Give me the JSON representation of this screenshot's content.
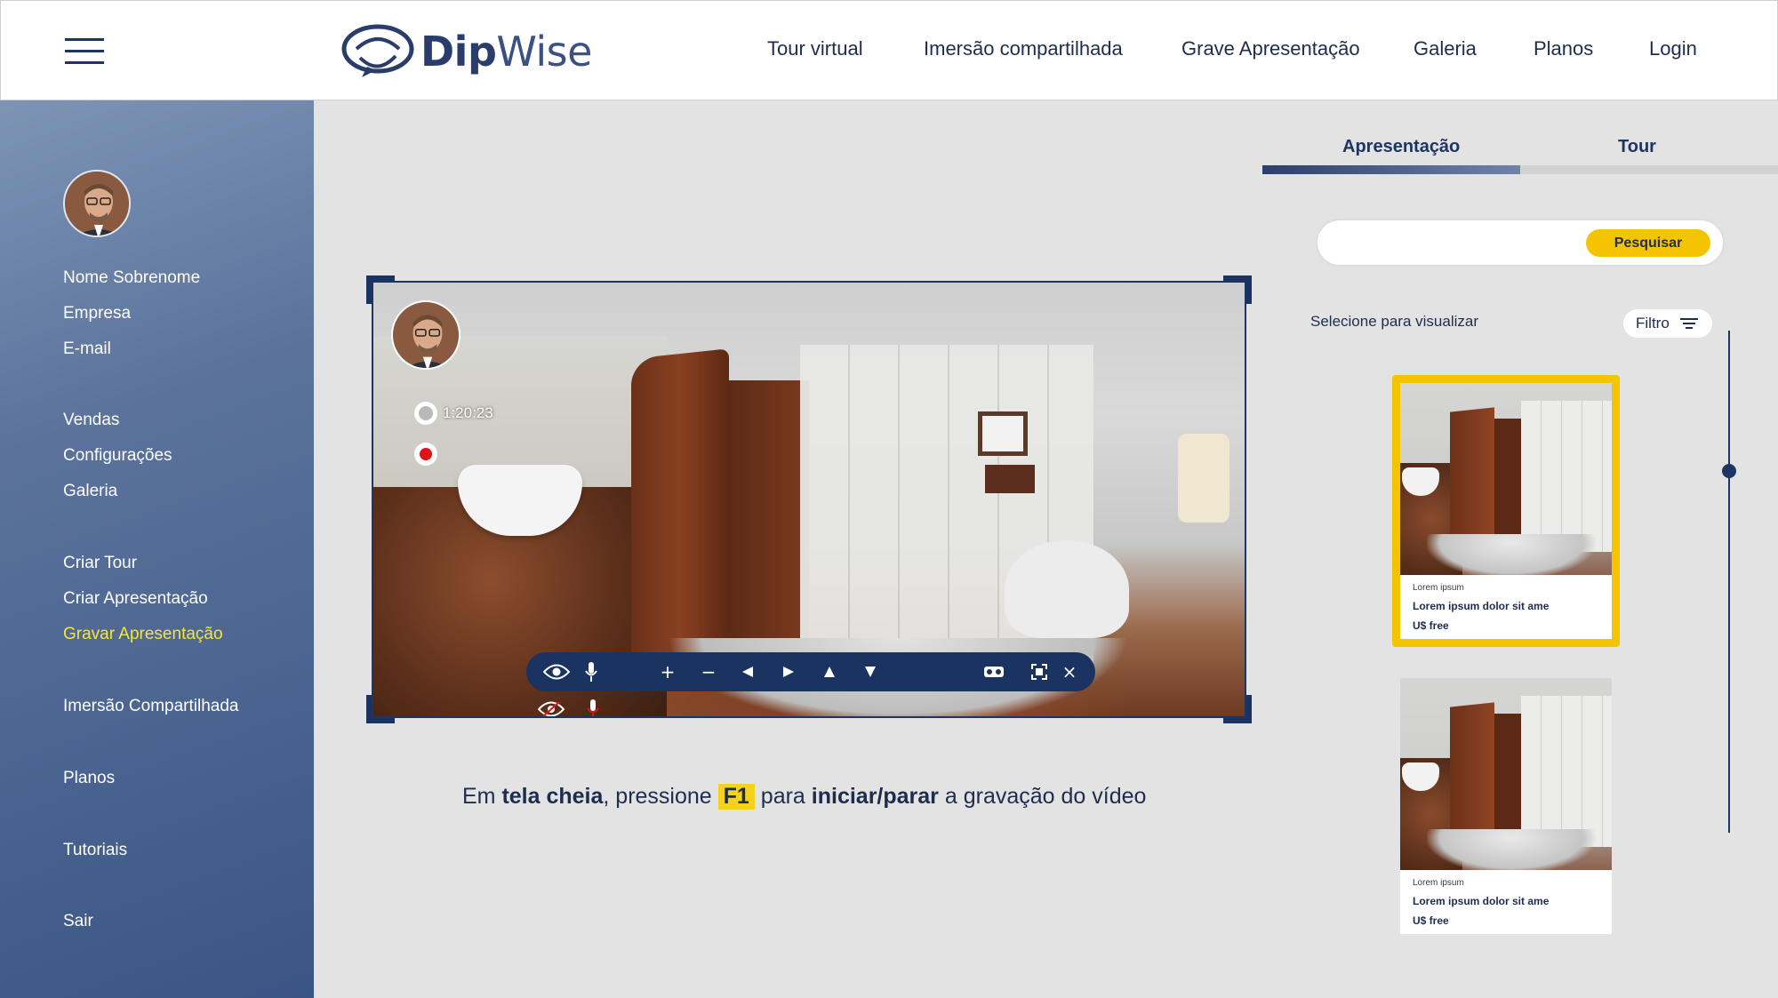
{
  "header": {
    "logo_bold": "Dip",
    "logo_light": "Wise",
    "nav": [
      "Tour virtual",
      "Imersão compartilhada",
      "Grave Apresentação",
      "Galeria",
      "Planos",
      "Login"
    ]
  },
  "sidebar": {
    "profile": [
      "Nome Sobrenome",
      "Empresa",
      "E-mail"
    ],
    "items": [
      {
        "label": "Vendas"
      },
      {
        "label": "Configurações"
      },
      {
        "label": "Galeria"
      },
      {
        "label": "Criar Tour"
      },
      {
        "label": "Criar Apresentação"
      },
      {
        "label": "Gravar Apresentação",
        "active": true
      },
      {
        "label": "Imersão Compartilhada"
      },
      {
        "label": "Planos"
      },
      {
        "label": "Tutoriais"
      },
      {
        "label": "Sair"
      }
    ]
  },
  "player": {
    "timer": "1:20:23",
    "controls": [
      "eye-icon",
      "mic-icon",
      "zoom-in-icon",
      "zoom-out-icon",
      "arrow-left-icon",
      "arrow-right-icon",
      "arrow-up-icon",
      "arrow-down-icon",
      "vr-headset-icon",
      "fullscreen-icon",
      "close-icon"
    ]
  },
  "hint": {
    "p1": "Em ",
    "b1": "tela cheia",
    "p2": ", pressione ",
    "key": "F1",
    "p3": " para ",
    "b2": "iniciar/parar",
    "p4": " a gravação do vídeo"
  },
  "panel": {
    "tabs": [
      "Apresentação",
      "Tour"
    ],
    "active_tab": "Apresentação",
    "search_button": "Pesquisar",
    "search_placeholder": "",
    "select_label": "Selecione para visualizar",
    "filter_label": "Filtro",
    "cards": [
      {
        "small": "Lorem ipsum",
        "title": "Lorem ipsum dolor sit ame",
        "price": "U$ free",
        "selected": true
      },
      {
        "small": "Lorem ipsum",
        "title": "Lorem ipsum dolor sit ame",
        "price": "U$ free",
        "selected": false
      }
    ]
  },
  "colors": {
    "navy": "#1e3461",
    "accent_yellow": "#f5c400",
    "active_sidebar": "#f3e73a",
    "record_red": "#e2121a"
  }
}
